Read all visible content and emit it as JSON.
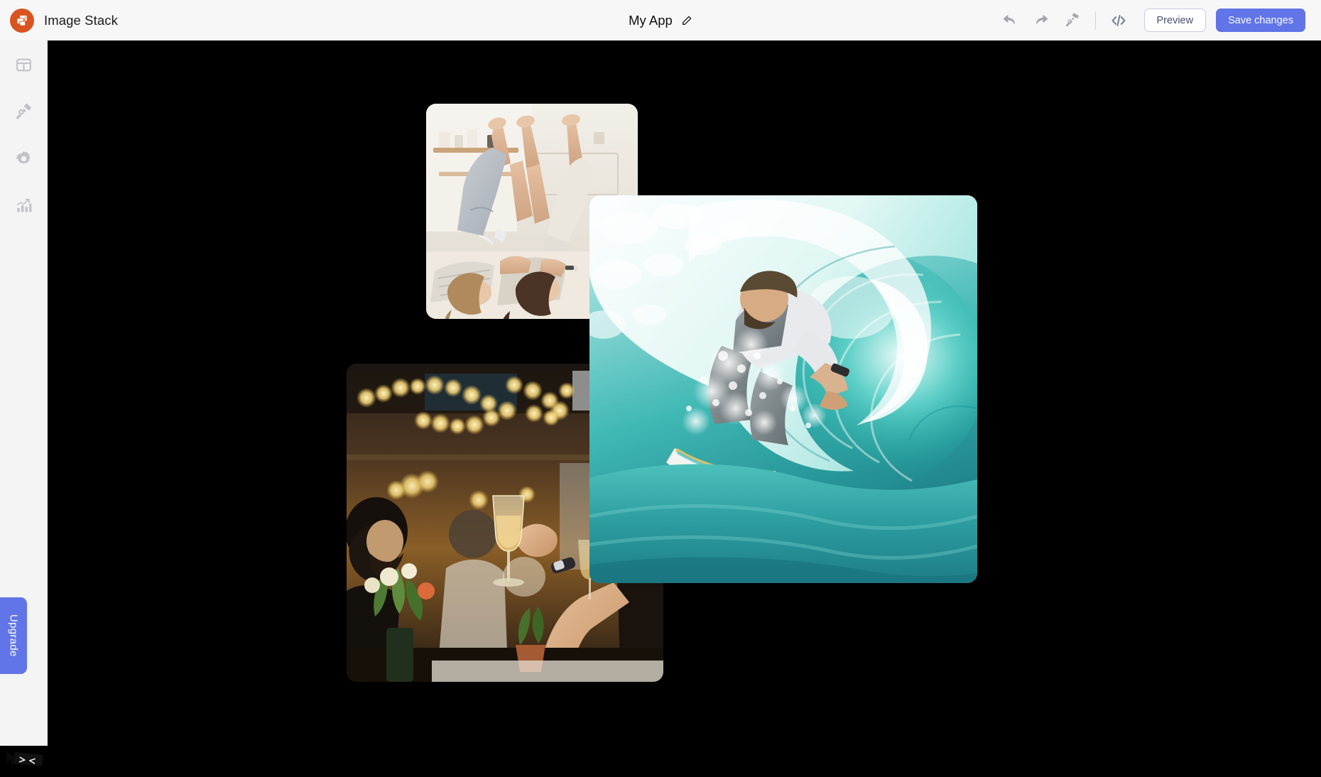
{
  "header": {
    "brand_name": "Image Stack",
    "logo_icon": "image-stack-logo-icon",
    "logo_color": "#d9541e",
    "app_title": "My App",
    "edit_icon": "pencil-icon",
    "tools": [
      {
        "name": "undo",
        "icon": "undo-arrow-icon",
        "label": "Undo"
      },
      {
        "name": "redo",
        "icon": "redo-arrow-icon",
        "label": "Redo"
      },
      {
        "name": "theme",
        "icon": "paint-roller-icon",
        "label": "Theme"
      },
      {
        "name": "code",
        "icon": "code-brackets-icon",
        "label": "Code"
      }
    ],
    "preview_label": "Preview",
    "save_label": "Save changes",
    "save_color": "#6174e8",
    "background": "#f7f7f7"
  },
  "sidebar": {
    "background": "#f4f4f5",
    "items": [
      {
        "name": "layout",
        "icon": "layout-grid-icon",
        "label": "Layout"
      },
      {
        "name": "design",
        "icon": "paintbrush-icon",
        "label": "Design"
      },
      {
        "name": "settings",
        "icon": "gear-icon",
        "label": "Settings"
      },
      {
        "name": "analytics",
        "icon": "bar-chart-icon",
        "label": "Analytics"
      }
    ],
    "upgrade_label": "Upgrade",
    "upgrade_color": "#6174e8",
    "cursor_icon": "mouse-cursor-icon"
  },
  "canvas": {
    "background": "#000000",
    "photos": [
      {
        "name": "photo-friends-on-bed",
        "alt": "Two people lying on a bed with legs up against the wall",
        "corner_radius": 14,
        "z": 2
      },
      {
        "name": "photo-surfer-in-wave",
        "alt": "Surfer riding inside a turquoise barrel wave",
        "corner_radius": 14,
        "z": 4
      },
      {
        "name": "photo-celebration-toast",
        "alt": "People raising champagne glasses under warm string lights",
        "corner_radius": 14,
        "z": 3
      }
    ]
  }
}
